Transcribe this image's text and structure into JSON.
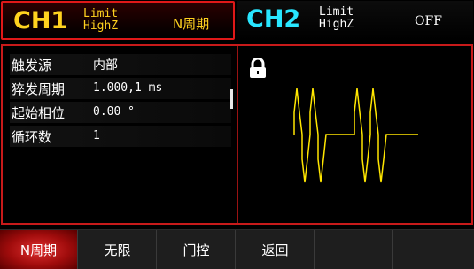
{
  "ch1": {
    "label": "CH1",
    "limit_line1": "Limit",
    "limit_line2": "HighZ",
    "mode": "N周期"
  },
  "ch2": {
    "label": "CH2",
    "limit_line1": "Limit",
    "limit_line2": "HighZ",
    "mode": "OFF"
  },
  "params": [
    {
      "label": "触发源",
      "value": "内部"
    },
    {
      "label": "猝发周期",
      "value": "1.000,1 ms"
    },
    {
      "label": "起始相位",
      "value": "0.00 °"
    },
    {
      "label": "循环数",
      "value": "1"
    }
  ],
  "menu": [
    {
      "label": "N周期"
    },
    {
      "label": "无限"
    },
    {
      "label": "门控"
    },
    {
      "label": "返回"
    },
    {
      "label": ""
    },
    {
      "label": ""
    }
  ],
  "colors": {
    "ch1": "#ffd21f",
    "ch2": "#28e6ff",
    "accent": "#c81a1a",
    "wave": "#ffe600"
  },
  "icons": {
    "lock": "lock-icon"
  }
}
